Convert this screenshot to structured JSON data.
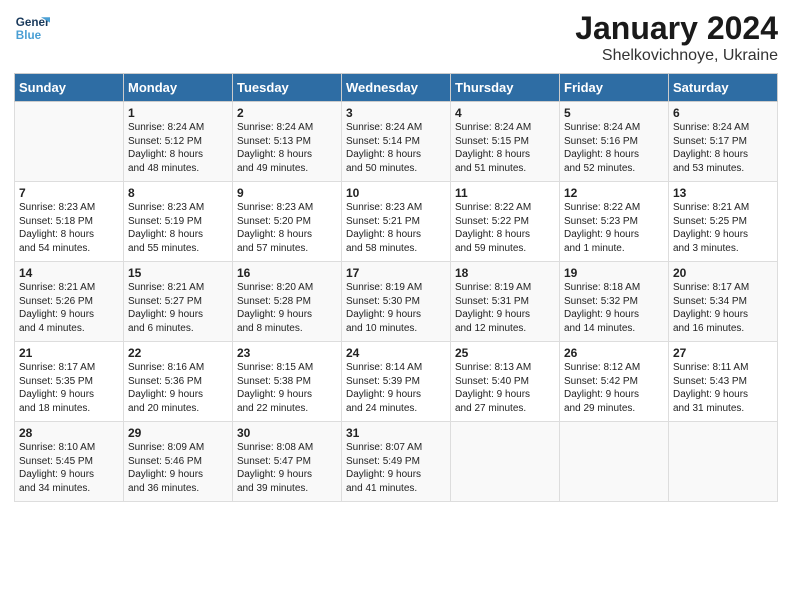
{
  "header": {
    "logo_line1": "General",
    "logo_line2": "Blue",
    "title": "January 2024",
    "subtitle": "Shelkovichnoye, Ukraine"
  },
  "days_of_week": [
    "Sunday",
    "Monday",
    "Tuesday",
    "Wednesday",
    "Thursday",
    "Friday",
    "Saturday"
  ],
  "weeks": [
    [
      {
        "day": "",
        "info": ""
      },
      {
        "day": "1",
        "info": "Sunrise: 8:24 AM\nSunset: 5:12 PM\nDaylight: 8 hours\nand 48 minutes."
      },
      {
        "day": "2",
        "info": "Sunrise: 8:24 AM\nSunset: 5:13 PM\nDaylight: 8 hours\nand 49 minutes."
      },
      {
        "day": "3",
        "info": "Sunrise: 8:24 AM\nSunset: 5:14 PM\nDaylight: 8 hours\nand 50 minutes."
      },
      {
        "day": "4",
        "info": "Sunrise: 8:24 AM\nSunset: 5:15 PM\nDaylight: 8 hours\nand 51 minutes."
      },
      {
        "day": "5",
        "info": "Sunrise: 8:24 AM\nSunset: 5:16 PM\nDaylight: 8 hours\nand 52 minutes."
      },
      {
        "day": "6",
        "info": "Sunrise: 8:24 AM\nSunset: 5:17 PM\nDaylight: 8 hours\nand 53 minutes."
      }
    ],
    [
      {
        "day": "7",
        "info": "Sunrise: 8:23 AM\nSunset: 5:18 PM\nDaylight: 8 hours\nand 54 minutes."
      },
      {
        "day": "8",
        "info": "Sunrise: 8:23 AM\nSunset: 5:19 PM\nDaylight: 8 hours\nand 55 minutes."
      },
      {
        "day": "9",
        "info": "Sunrise: 8:23 AM\nSunset: 5:20 PM\nDaylight: 8 hours\nand 57 minutes."
      },
      {
        "day": "10",
        "info": "Sunrise: 8:23 AM\nSunset: 5:21 PM\nDaylight: 8 hours\nand 58 minutes."
      },
      {
        "day": "11",
        "info": "Sunrise: 8:22 AM\nSunset: 5:22 PM\nDaylight: 8 hours\nand 59 minutes."
      },
      {
        "day": "12",
        "info": "Sunrise: 8:22 AM\nSunset: 5:23 PM\nDaylight: 9 hours\nand 1 minute."
      },
      {
        "day": "13",
        "info": "Sunrise: 8:21 AM\nSunset: 5:25 PM\nDaylight: 9 hours\nand 3 minutes."
      }
    ],
    [
      {
        "day": "14",
        "info": "Sunrise: 8:21 AM\nSunset: 5:26 PM\nDaylight: 9 hours\nand 4 minutes."
      },
      {
        "day": "15",
        "info": "Sunrise: 8:21 AM\nSunset: 5:27 PM\nDaylight: 9 hours\nand 6 minutes."
      },
      {
        "day": "16",
        "info": "Sunrise: 8:20 AM\nSunset: 5:28 PM\nDaylight: 9 hours\nand 8 minutes."
      },
      {
        "day": "17",
        "info": "Sunrise: 8:19 AM\nSunset: 5:30 PM\nDaylight: 9 hours\nand 10 minutes."
      },
      {
        "day": "18",
        "info": "Sunrise: 8:19 AM\nSunset: 5:31 PM\nDaylight: 9 hours\nand 12 minutes."
      },
      {
        "day": "19",
        "info": "Sunrise: 8:18 AM\nSunset: 5:32 PM\nDaylight: 9 hours\nand 14 minutes."
      },
      {
        "day": "20",
        "info": "Sunrise: 8:17 AM\nSunset: 5:34 PM\nDaylight: 9 hours\nand 16 minutes."
      }
    ],
    [
      {
        "day": "21",
        "info": "Sunrise: 8:17 AM\nSunset: 5:35 PM\nDaylight: 9 hours\nand 18 minutes."
      },
      {
        "day": "22",
        "info": "Sunrise: 8:16 AM\nSunset: 5:36 PM\nDaylight: 9 hours\nand 20 minutes."
      },
      {
        "day": "23",
        "info": "Sunrise: 8:15 AM\nSunset: 5:38 PM\nDaylight: 9 hours\nand 22 minutes."
      },
      {
        "day": "24",
        "info": "Sunrise: 8:14 AM\nSunset: 5:39 PM\nDaylight: 9 hours\nand 24 minutes."
      },
      {
        "day": "25",
        "info": "Sunrise: 8:13 AM\nSunset: 5:40 PM\nDaylight: 9 hours\nand 27 minutes."
      },
      {
        "day": "26",
        "info": "Sunrise: 8:12 AM\nSunset: 5:42 PM\nDaylight: 9 hours\nand 29 minutes."
      },
      {
        "day": "27",
        "info": "Sunrise: 8:11 AM\nSunset: 5:43 PM\nDaylight: 9 hours\nand 31 minutes."
      }
    ],
    [
      {
        "day": "28",
        "info": "Sunrise: 8:10 AM\nSunset: 5:45 PM\nDaylight: 9 hours\nand 34 minutes."
      },
      {
        "day": "29",
        "info": "Sunrise: 8:09 AM\nSunset: 5:46 PM\nDaylight: 9 hours\nand 36 minutes."
      },
      {
        "day": "30",
        "info": "Sunrise: 8:08 AM\nSunset: 5:47 PM\nDaylight: 9 hours\nand 39 minutes."
      },
      {
        "day": "31",
        "info": "Sunrise: 8:07 AM\nSunset: 5:49 PM\nDaylight: 9 hours\nand 41 minutes."
      },
      {
        "day": "",
        "info": ""
      },
      {
        "day": "",
        "info": ""
      },
      {
        "day": "",
        "info": ""
      }
    ]
  ]
}
